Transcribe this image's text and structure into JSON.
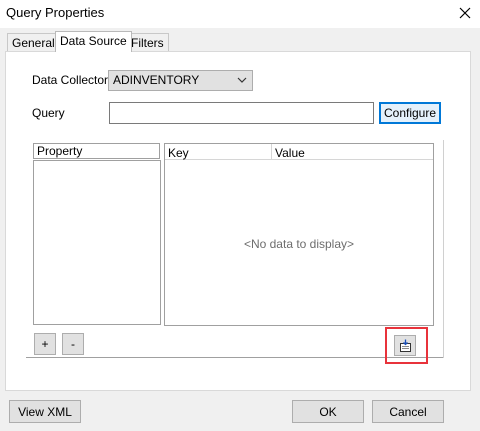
{
  "window": {
    "title": "Query Properties"
  },
  "tabs": [
    {
      "label": "General"
    },
    {
      "label": "Data Source"
    },
    {
      "label": "Filters"
    }
  ],
  "form": {
    "data_collector_label": "Data Collector",
    "data_collector_value": "ADINVENTORY",
    "query_label": "Query",
    "query_value": "",
    "configure_label": "Configure"
  },
  "property_list": {
    "header": "Property",
    "items": []
  },
  "grid": {
    "columns": [
      "Key",
      "Value"
    ],
    "empty_text": "<No data to display>"
  },
  "list_buttons": {
    "add": "+",
    "remove": "-"
  },
  "footer": {
    "view_xml": "View XML",
    "ok": "OK",
    "cancel": "Cancel"
  },
  "colors": {
    "focus_blue": "#0078d7",
    "highlight_red": "#e8333b"
  },
  "icons": {
    "close": "close-icon",
    "import": "import-icon"
  }
}
